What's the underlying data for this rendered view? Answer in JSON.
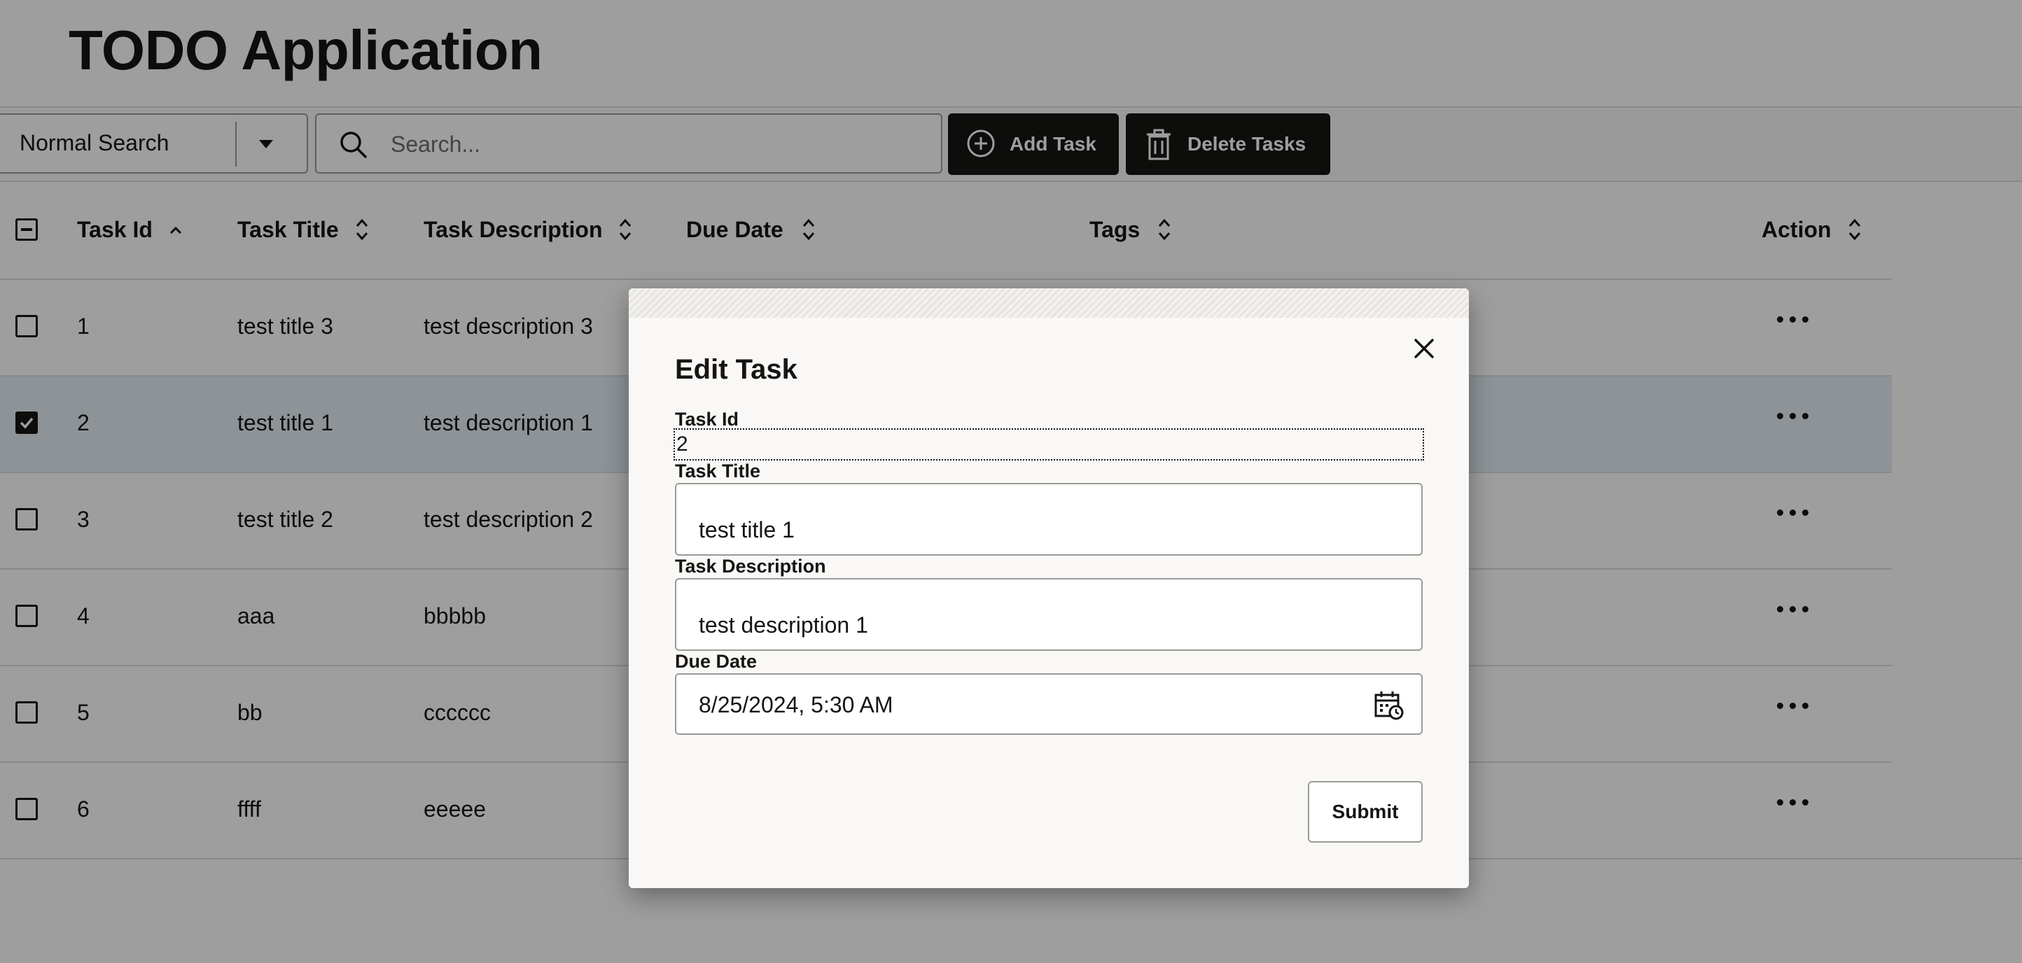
{
  "app": {
    "title": "TODO Application"
  },
  "toolbar": {
    "search_mode": "Normal Search",
    "search_placeholder": "Search...",
    "add_task_label": "Add Task",
    "delete_tasks_label": "Delete Tasks"
  },
  "table": {
    "columns": [
      "Task Id",
      "Task Title",
      "Task Description",
      "Due Date",
      "Tags",
      "Action"
    ],
    "rows": [
      {
        "id": "1",
        "title": "test title 3",
        "description": "test description 3",
        "selected": false
      },
      {
        "id": "2",
        "title": "test title 1",
        "description": "test description 1",
        "selected": true
      },
      {
        "id": "3",
        "title": "test title 2",
        "description": "test description 2",
        "selected": false
      },
      {
        "id": "4",
        "title": "aaa",
        "description": "bbbbb",
        "selected": false
      },
      {
        "id": "5",
        "title": "bb",
        "description": "cccccc",
        "selected": false
      },
      {
        "id": "6",
        "title": "ffff",
        "description": "eeeee",
        "selected": false
      }
    ]
  },
  "dialog": {
    "title": "Edit Task",
    "task_id_label": "Task Id",
    "task_id_value": "2",
    "task_title_label": "Task Title",
    "task_title_value": "test title 1",
    "task_description_label": "Task Description",
    "task_description_value": "test description 1",
    "due_date_label": "Due Date",
    "due_date_value": "8/25/2024, 5:30 AM",
    "submit_label": "Submit"
  },
  "colors": {
    "primary_button": "#161513",
    "selected_row": "#e4edf4",
    "border": "#9c9a96"
  },
  "icons": [
    "search-icon",
    "add-circle-icon",
    "trash-icon",
    "sort-icon",
    "ellipsis-icon",
    "close-icon",
    "calendar-icon",
    "checkbox-icon"
  ]
}
